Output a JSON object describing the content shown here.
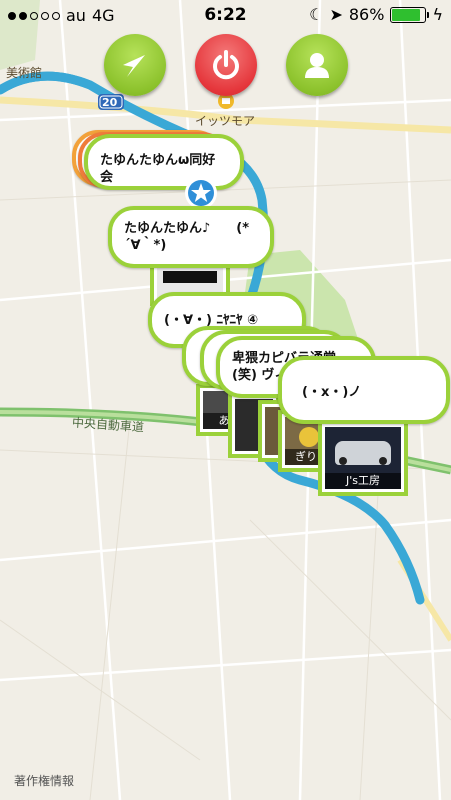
{
  "status_bar": {
    "carrier": "au",
    "network": "4G",
    "time": "6:22",
    "battery": "86%",
    "battery_level": 0.86
  },
  "toolbar": {
    "location_icon": "navigation-arrow-icon",
    "power_icon": "power-icon",
    "profile_icon": "user-icon"
  },
  "map": {
    "labels": {
      "museum": "美術館",
      "route_number": "20",
      "store": "イッツモア",
      "expressway": "中央自動車道"
    },
    "copyright": "著作権情報"
  },
  "pins": [
    {
      "label": "たゆんたゆんω同好会"
    },
    {
      "label": "たゆんたゆん♪　　(*´∀｀*)"
    },
    {
      "label": "(・∀・) ﾆﾔﾆﾔ ④"
    },
    {
      "label": "卑猥カピバラ通常(笑) ヴィラオ"
    },
    {
      "label": "(・x・)ノ"
    }
  ],
  "photo_captions": {
    "js_koubou": "J's工房",
    "giri": "ぎり",
    "a": "あ"
  },
  "colors": {
    "accent_green": "#9bd13a",
    "power_red": "#e5363b",
    "river_blue": "#3aa8d6"
  }
}
